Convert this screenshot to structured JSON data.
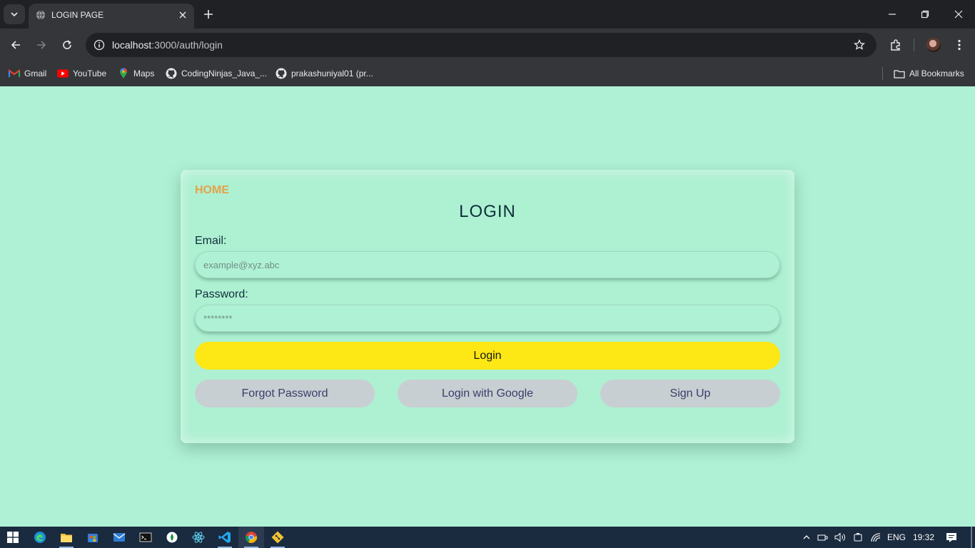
{
  "browser": {
    "tab_title": "LOGIN PAGE",
    "url_host": "localhost",
    "url_path": ":3000/auth/login"
  },
  "bookmarks": {
    "items": [
      {
        "label": "Gmail",
        "icon": "gmail-icon"
      },
      {
        "label": "YouTube",
        "icon": "youtube-icon"
      },
      {
        "label": "Maps",
        "icon": "maps-icon"
      },
      {
        "label": "CodingNinjas_Java_...",
        "icon": "github-icon"
      },
      {
        "label": "prakashuniyal01 (pr...",
        "icon": "github-icon"
      }
    ],
    "all_bookmarks": "All Bookmarks"
  },
  "page": {
    "home_link": "HOME",
    "title": "LOGIN",
    "email_label": "Email:",
    "email_placeholder": "example@xyz.abc",
    "password_label": "Password:",
    "password_placeholder": "********",
    "login_button": "Login",
    "forgot_button": "Forgot Password",
    "google_button": "Login with Google",
    "signup_button": "Sign Up"
  },
  "colors": {
    "page_background": "#aff1d4",
    "home_link": "#e5a24a",
    "login_button": "#fde714",
    "secondary_button": "#c8cfd2"
  },
  "taskbar": {
    "language": "ENG",
    "time": "19:32"
  }
}
